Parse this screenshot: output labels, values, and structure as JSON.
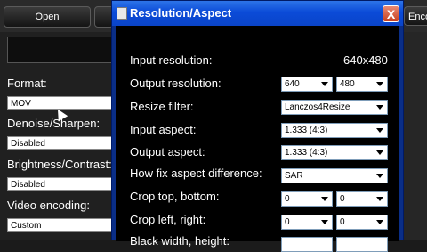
{
  "toolbar": {
    "open_label": "Open",
    "encode_label": "Enco"
  },
  "left_panel": {
    "format_label": "Format:",
    "format_value": "MOV",
    "denoise_label": "Denoise/Sharpen:",
    "denoise_value": "Disabled",
    "brightness_label": "Brightness/Contrast:",
    "brightness_value": "Disabled",
    "video_encoding_label": "Video encoding:",
    "video_encoding_value": "Custom"
  },
  "dialog": {
    "title": "Resolution/Aspect",
    "close_label": "X",
    "input_resolution_label": "Input resolution:",
    "input_resolution_value": "640x480",
    "output_resolution_label": "Output resolution:",
    "output_width": "640",
    "output_height": "480",
    "resize_filter_label": "Resize filter:",
    "resize_filter_value": "Lanczos4Resize",
    "input_aspect_label": "Input aspect:",
    "input_aspect_value": "1.333 (4:3)",
    "output_aspect_label": "Output aspect:",
    "output_aspect_value": "1.333 (4:3)",
    "fix_aspect_label": "How fix aspect difference:",
    "fix_aspect_value": "SAR",
    "crop_tb_label": "Crop top, bottom:",
    "crop_top": "0",
    "crop_bottom": "0",
    "crop_lr_label": "Crop left, right:",
    "crop_left": "0",
    "crop_right": "0",
    "black_wh_label": "Black width, height:"
  }
}
